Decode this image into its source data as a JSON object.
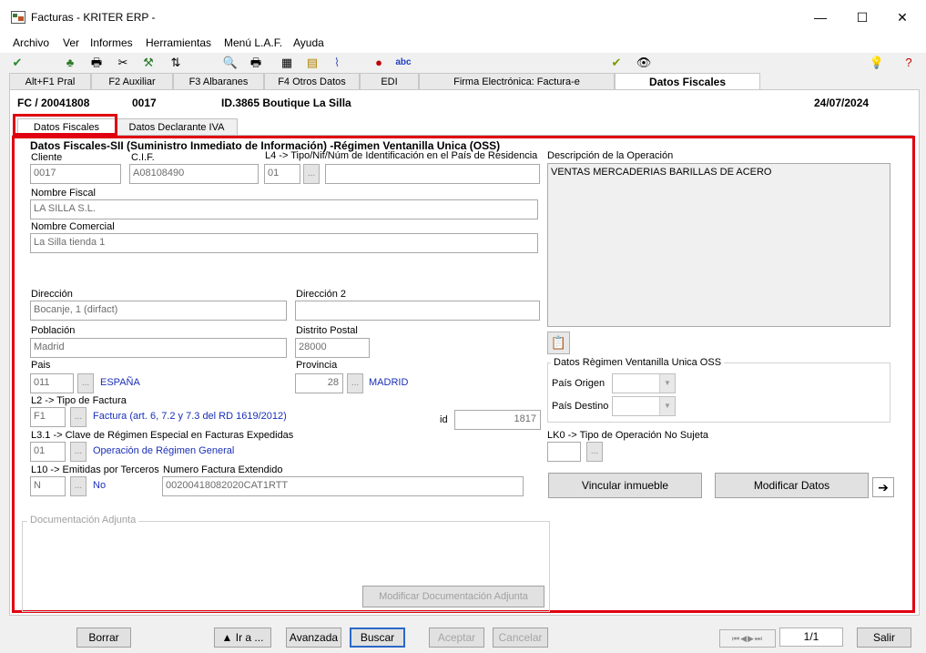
{
  "window": {
    "title": "Facturas - KRITER ERP -",
    "minimize": "—",
    "maximize": "☐",
    "close": "✕"
  },
  "menu": [
    "Archivo",
    "Ver",
    "Informes",
    "Herramientas",
    "Menú L.A.F.",
    "Ayuda"
  ],
  "toolbar": {
    "spell_label": "abc"
  },
  "main_tabs": [
    "Alt+F1 Pral",
    "F2 Auxiliar",
    "F3 Albaranes",
    "F4 Otros Datos",
    "EDI",
    "Firma Electrónica: Factura-e",
    "Datos Fiscales"
  ],
  "header": {
    "doc_number": "FC / 20041808",
    "client_code": "0017",
    "client_name": "ID.3865 Boutique La Silla",
    "date": "24/07/2024"
  },
  "sub_tabs": [
    "Datos Fiscales",
    "Datos Declarante IVA"
  ],
  "section_title": "Datos Fiscales-SII (Suministro Inmediato de Información) -Régimen Ventanilla Unica (OSS)",
  "fields": {
    "cliente": {
      "label": "Cliente",
      "value": "0017"
    },
    "cif": {
      "label": "C.I.F.",
      "value": "A08108490"
    },
    "l4": {
      "label": "L4 -> Tipo/Nif/Núm de Identificación en el País de Residencia",
      "value": "01",
      "extra": ""
    },
    "nombre_fiscal": {
      "label": "Nombre Fiscal",
      "value": "LA SILLA S.L."
    },
    "nombre_comercial": {
      "label": "Nombre Comercial",
      "value": "La Silla tienda 1"
    },
    "direccion": {
      "label": "Dirección",
      "value": "Bocanje, 1 (dirfact)"
    },
    "direccion2": {
      "label": "Dirección 2",
      "value": ""
    },
    "poblacion": {
      "label": "Población",
      "value": "Madrid"
    },
    "distrito_postal": {
      "label": "Distrito Postal",
      "value": "28000"
    },
    "pais": {
      "label": "Pais",
      "value": "011",
      "desc": "ESPAÑA"
    },
    "provincia": {
      "label": "Provincia",
      "value": "28",
      "desc": "MADRID"
    },
    "l2": {
      "label": "L2 -> Tipo de Factura",
      "value": "F1",
      "desc": "Factura (art. 6, 7.2 y 7.3 del RD 1619/2012)"
    },
    "id": {
      "label": "id",
      "value": "1817"
    },
    "l31": {
      "label": "L3.1 -> Clave de Régimen Especial en Facturas Expedidas",
      "value": "01",
      "desc": "Operación de Régimen General"
    },
    "l10": {
      "label": "L10 -> Emitidas por Terceros",
      "value": "N",
      "desc": "No"
    },
    "num_factura_ext": {
      "label": "Numero Factura Extendido",
      "value": "00200418082020CAT1RTT"
    },
    "descripcion": {
      "label": "Descripción de la Operación",
      "value": "VENTAS MERCADERIAS BARILLAS DE ACERO"
    },
    "lk0": {
      "label": "LK0 -> Tipo de Operación No Sujeta",
      "value": ""
    }
  },
  "dot_label": "...",
  "oss": {
    "title": "Datos Règimen Ventanilla Unica OSS",
    "origen_label": "País Origen",
    "destino_label": "País Destino"
  },
  "buttons": {
    "vincular": "Vincular inmueble",
    "modificar": "Modificar Datos",
    "arrow": "➔",
    "mod_doc": "Modificar Documentación Adjunta"
  },
  "doc_adjunta": {
    "title": "Documentación Adjunta"
  },
  "bottom": {
    "borrar": "Borrar",
    "ira": "▲ Ir a ...",
    "avanzada": "Avanzada",
    "buscar": "Buscar",
    "aceptar": "Aceptar",
    "cancelar": "Cancelar",
    "page": "1/1",
    "salir": "Salir"
  }
}
